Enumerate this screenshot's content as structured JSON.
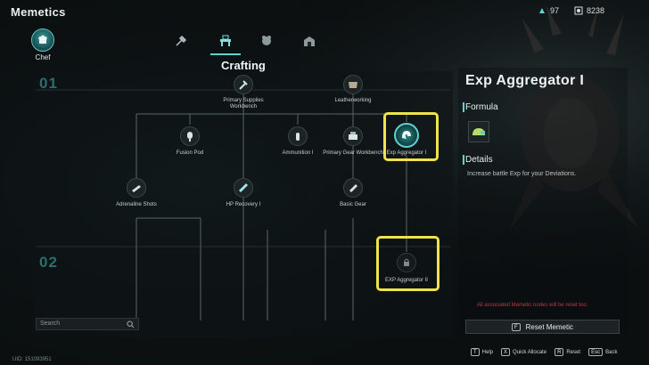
{
  "app": {
    "title": "Memetics"
  },
  "resources": [
    {
      "name": "energy",
      "value": "97"
    },
    {
      "name": "points",
      "value": "8238"
    }
  ],
  "category": {
    "label": "Chef"
  },
  "tabs": [
    {
      "icon": "axe-icon",
      "active": false
    },
    {
      "icon": "workbench-icon",
      "active": true
    },
    {
      "icon": "creature-icon",
      "active": false
    },
    {
      "icon": "building-icon",
      "active": false
    }
  ],
  "tree": {
    "title": "Crafting",
    "tiers": [
      "01",
      "02"
    ],
    "nodes": {
      "primary_supplies": "Primary Supplies Workbench",
      "leatherworking": "Leatherworking",
      "fusion_pod": "Fusion Pod",
      "ammunition": "Ammunition I",
      "primary_gear": "Primary Gear Workbench",
      "exp_aggregator_1": "Exp Aggregator I",
      "adrenaline": "Adrenaline Shots",
      "hp_recovery": "HP Recovery I",
      "basic_gear": "Basic Gear",
      "exp_aggregator_2": "EXP Aggregator II"
    }
  },
  "search": {
    "placeholder": "Search"
  },
  "uid": "UID: 151093951",
  "detail": {
    "title": "Exp Aggregator I",
    "formula_heading": "Formula",
    "details_heading": "Details",
    "description": "Increase battle Exp for your Deviations.",
    "warning": "All associated Memetic nodes will be reset too."
  },
  "reset": {
    "key": "F",
    "label": "Reset Memetic"
  },
  "hints": [
    {
      "key": "T",
      "label": "Help"
    },
    {
      "key": "X",
      "label": "Quick Allocate"
    },
    {
      "key": "R",
      "label": "Reset"
    },
    {
      "key": "Esc",
      "label": "Back"
    }
  ],
  "colors": {
    "accent": "#5fd3d0",
    "highlight": "#f0e24a",
    "warning": "#c0393b"
  }
}
